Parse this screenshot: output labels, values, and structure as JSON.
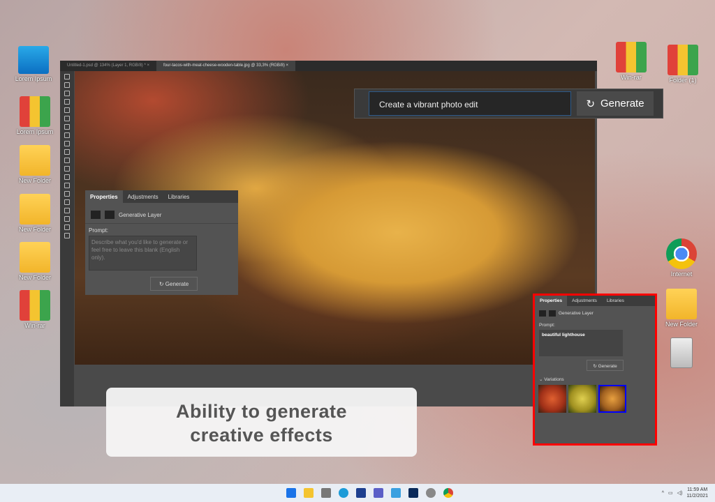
{
  "desktop": {
    "icons_left": [
      "Lorem Ipsum",
      "Lorem Ipsum",
      "New Folder",
      "New Folder",
      "New Folder",
      "Win-rar"
    ],
    "icons_right": [
      "Win-rar",
      "Folder (1)",
      "Internet",
      "New Folder"
    ]
  },
  "photoshop": {
    "tabs": [
      "Untitled-1.psd @ 134% (Layer 1, RGB/8) *",
      "four-tacos-with-meat-cheese-wooden-table.jpg @ 33,3% (RGB/8)"
    ],
    "close_symbol": "×"
  },
  "gen_bar": {
    "prompt": "Create a vibrant photo edit",
    "button": "Generate"
  },
  "props_left": {
    "tabs": [
      "Properties",
      "Adjustments",
      "Libraries"
    ],
    "layer": "Generative Layer",
    "prompt_label": "Prompt:",
    "placeholder": "Describe what you'd like to generate or feel free to leave this blank (English only).",
    "button": "Generate"
  },
  "props_right": {
    "tabs": [
      "Properties",
      "Adjustments",
      "Libraries"
    ],
    "layer": "Generative Layer",
    "prompt_label": "Prompt:",
    "prompt_value": "beautiful lighthouse",
    "button": "Generate",
    "variations_label": "Variations"
  },
  "caption": {
    "line1": "Ability to generate",
    "line2": "creative effects"
  },
  "taskbar": {
    "time": "11:59 AM",
    "date": "11/2/2021"
  },
  "colors": {
    "highlight": "#ff0000",
    "selected_variation": "#0000ff"
  }
}
